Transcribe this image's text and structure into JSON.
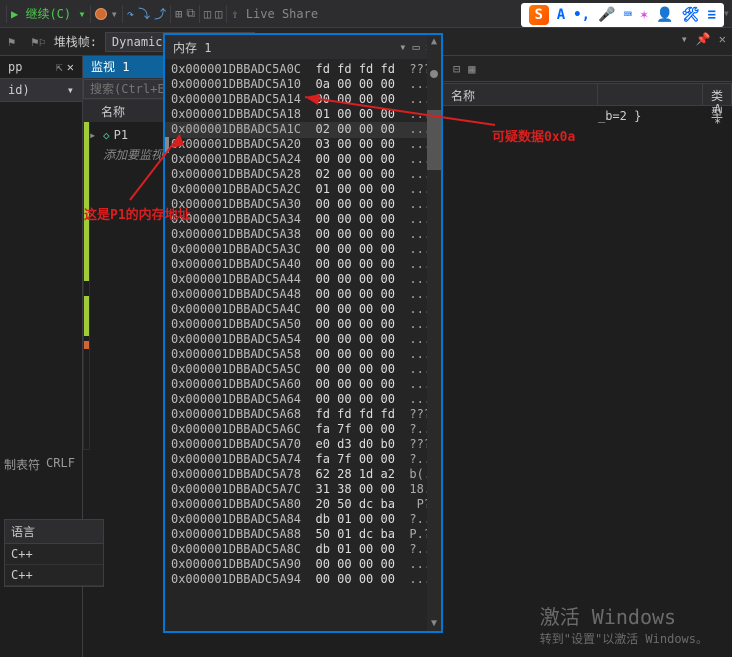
{
  "toolbar": {
    "continueBtn": "继续(C)",
    "liveShare": "Live Share"
  },
  "sogou": {
    "logo": "S",
    "letter": "A"
  },
  "row2": {
    "stackLabel": "堆栈帧:",
    "stackValue": "DynamicM..."
  },
  "leftTabs": {
    "file": "pp",
    "pin": "⇱",
    "close": "✕",
    "id": "id)"
  },
  "watchPanel": {
    "title": "监视 1",
    "searchPlaceholder": "搜索(Ctrl+E)",
    "treeHeader": "名称",
    "items": [
      {
        "icon": "◇",
        "name": "P1"
      },
      {
        "name": "添加要监视..."
      }
    ]
  },
  "rightPanel": {
    "headers": [
      "名称",
      "",
      "类型"
    ],
    "row": {
      "name": "",
      "val": "_b=2 }",
      "type": "A *"
    }
  },
  "annotation": {
    "left": "这是P1的内存地址",
    "right": "可疑数据0x0a"
  },
  "memPanel": {
    "title": "内存 1",
    "rows": [
      {
        "addr": "0x000001DBBADC5A0C",
        "bytes": "fd fd fd fd",
        "asc": "????"
      },
      {
        "addr": "0x000001DBBADC5A10",
        "bytes": "0a 00 00 00",
        "asc": "...."
      },
      {
        "addr": "0x000001DBBADC5A14",
        "bytes": "00 00 00 00",
        "asc": "...."
      },
      {
        "addr": "0x000001DBBADC5A18",
        "bytes": "01 00 00 00",
        "asc": "...."
      },
      {
        "addr": "0x000001DBBADC5A1C",
        "bytes": "02 00 00 00",
        "asc": "...."
      },
      {
        "addr": "0x000001DBBADC5A20",
        "bytes": "03 00 00 00",
        "asc": "...."
      },
      {
        "addr": "0x000001DBBADC5A24",
        "bytes": "00 00 00 00",
        "asc": "...."
      },
      {
        "addr": "0x000001DBBADC5A28",
        "bytes": "02 00 00 00",
        "asc": "...."
      },
      {
        "addr": "0x000001DBBADC5A2C",
        "bytes": "01 00 00 00",
        "asc": "...."
      },
      {
        "addr": "0x000001DBBADC5A30",
        "bytes": "00 00 00 00",
        "asc": "...."
      },
      {
        "addr": "0x000001DBBADC5A34",
        "bytes": "00 00 00 00",
        "asc": "...."
      },
      {
        "addr": "0x000001DBBADC5A38",
        "bytes": "00 00 00 00",
        "asc": "...."
      },
      {
        "addr": "0x000001DBBADC5A3C",
        "bytes": "00 00 00 00",
        "asc": "...."
      },
      {
        "addr": "0x000001DBBADC5A40",
        "bytes": "00 00 00 00",
        "asc": "...."
      },
      {
        "addr": "0x000001DBBADC5A44",
        "bytes": "00 00 00 00",
        "asc": "...."
      },
      {
        "addr": "0x000001DBBADC5A48",
        "bytes": "00 00 00 00",
        "asc": "...."
      },
      {
        "addr": "0x000001DBBADC5A4C",
        "bytes": "00 00 00 00",
        "asc": "...."
      },
      {
        "addr": "0x000001DBBADC5A50",
        "bytes": "00 00 00 00",
        "asc": "...."
      },
      {
        "addr": "0x000001DBBADC5A54",
        "bytes": "00 00 00 00",
        "asc": "...."
      },
      {
        "addr": "0x000001DBBADC5A58",
        "bytes": "00 00 00 00",
        "asc": "...."
      },
      {
        "addr": "0x000001DBBADC5A5C",
        "bytes": "00 00 00 00",
        "asc": "...."
      },
      {
        "addr": "0x000001DBBADC5A60",
        "bytes": "00 00 00 00",
        "asc": "...."
      },
      {
        "addr": "0x000001DBBADC5A64",
        "bytes": "00 00 00 00",
        "asc": "...."
      },
      {
        "addr": "0x000001DBBADC5A68",
        "bytes": "fd fd fd fd",
        "asc": "????"
      },
      {
        "addr": "0x000001DBBADC5A6C",
        "bytes": "fa 7f 00 00",
        "asc": "?..."
      },
      {
        "addr": "0x000001DBBADC5A70",
        "bytes": "e0 d3 d0 b0",
        "asc": "????"
      },
      {
        "addr": "0x000001DBBADC5A74",
        "bytes": "fa 7f 00 00",
        "asc": "?..."
      },
      {
        "addr": "0x000001DBBADC5A78",
        "bytes": "62 28 1d a2",
        "asc": "b(.?"
      },
      {
        "addr": "0x000001DBBADC5A7C",
        "bytes": "31 38 00 00",
        "asc": "18.."
      },
      {
        "addr": "0x000001DBBADC5A80",
        "bytes": "20 50 dc ba",
        "asc": " P??"
      },
      {
        "addr": "0x000001DBBADC5A84",
        "bytes": "db 01 00 00",
        "asc": "?..."
      },
      {
        "addr": "0x000001DBBADC5A88",
        "bytes": "50 01 dc ba",
        "asc": "P.??"
      },
      {
        "addr": "0x000001DBBADC5A8C",
        "bytes": "db 01 00 00",
        "asc": "?..."
      },
      {
        "addr": "0x000001DBBADC5A90",
        "bytes": "00 00 00 00",
        "asc": "...."
      },
      {
        "addr": "0x000001DBBADC5A94",
        "bytes": "00 00 00 00",
        "asc": "...."
      }
    ]
  },
  "statusbar": {
    "tabs": "制表符",
    "crlf": "CRLF"
  },
  "langPanel": {
    "header": "语言",
    "rows": [
      "C++",
      "C++"
    ]
  },
  "activate": {
    "t1": "激活 Windows",
    "t2": "转到\"设置\"以激活 Windows。"
  }
}
